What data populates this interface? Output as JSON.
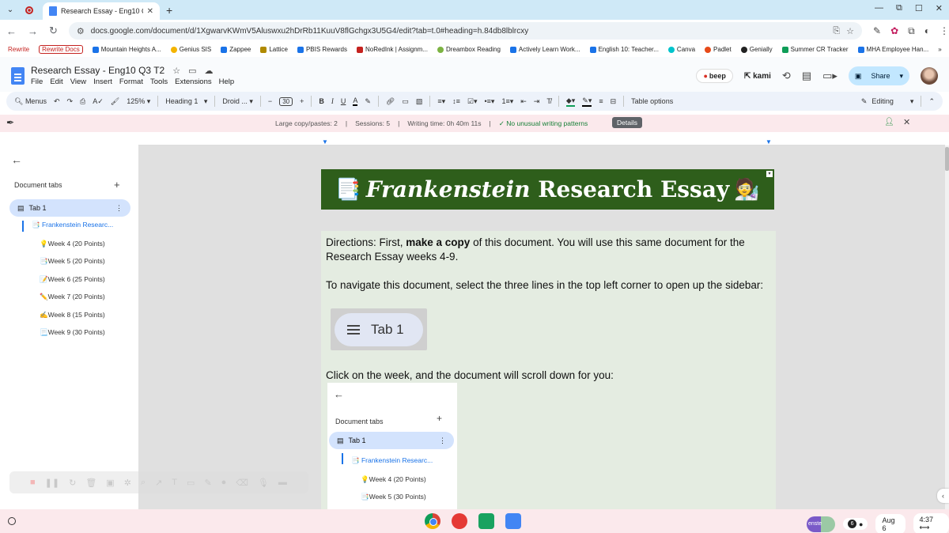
{
  "browser": {
    "tab_title": "Research Essay - Eng10 Q3 T2",
    "url": "docs.google.com/document/d/1XgwarvKWmV5Aluswxu2hDrRb11KuuV8flGchgx3U5G4/edit?tab=t.0#heading=h.84db8lblrcxy"
  },
  "bookmarks": [
    "Rewrite",
    "Rewrite Docs",
    "Mountain Heights A...",
    "Genius SIS",
    "Zappee",
    "Lattice",
    "PBIS Rewards",
    "NoRedInk | Assignm...",
    "Dreambox Reading",
    "Actively Learn Work...",
    "English 10: Teacher...",
    "Canva",
    "Padlet",
    "Genially",
    "Summer CR Tracker",
    "MHA Employee Han..."
  ],
  "docs": {
    "title": "Research Essay - Eng10 Q3 T2",
    "menus": [
      "File",
      "Edit",
      "View",
      "Insert",
      "Format",
      "Tools",
      "Extensions",
      "Help"
    ],
    "beep": "beep",
    "kami": "kami",
    "share": "Share"
  },
  "toolbar": {
    "menus": "Menus",
    "zoom": "125%",
    "style": "Heading 1",
    "font": "Droid ...",
    "font_size": "30",
    "bold": "B",
    "italic": "I",
    "underline": "U",
    "text_color": "A",
    "table_options": "Table options",
    "mode": "Editing"
  },
  "banner": {
    "copy_pastes": "Large copy/pastes: 2",
    "sessions": "Sessions: 5",
    "writing_time": "Writing time: 0h 40m 11s",
    "status": "✓ No unusual writing patterns",
    "details": "Details"
  },
  "sidebar": {
    "heading": "Document tabs",
    "tab": "Tab 1",
    "doc_link": "📑 Frankenstein Researc...",
    "items": [
      "💡Week 4 (20 Points)",
      "📑Week 5 (20 Points)",
      "📝Week 6 (25 Points)",
      "✏️Week 7 (20 Points)",
      "✍️Week 8 (15 Points)",
      "📃Week 9 (30 Points)"
    ]
  },
  "document": {
    "title_italic": "Frankenstein",
    "title_rest": " Research Essay",
    "title_emoji_left": "📑",
    "title_emoji_right": "🧑‍🔬",
    "directions_pre": "Directions: First, ",
    "directions_bold": "make a copy",
    "directions_post": " of this document. You will use this same document for the Research Essay weeks 4-9.",
    "navigate": "To navigate this document, select the three lines in the top left corner to open up the sidebar:",
    "img_tab_label": "Tab 1",
    "click_week": "Click on the week, and the document will scroll down for you:",
    "img_sidebar": {
      "heading": "Document tabs",
      "tab": "Tab 1",
      "doc_link": "📑 Frankenstein Researc...",
      "item1": "💡Week 4 (20 Points)",
      "item2": "📑Week 5 (30 Points)"
    }
  },
  "shelf": {
    "tray_user": "enste",
    "notifications": "6",
    "date": "Aug 6",
    "time": "4:37"
  }
}
